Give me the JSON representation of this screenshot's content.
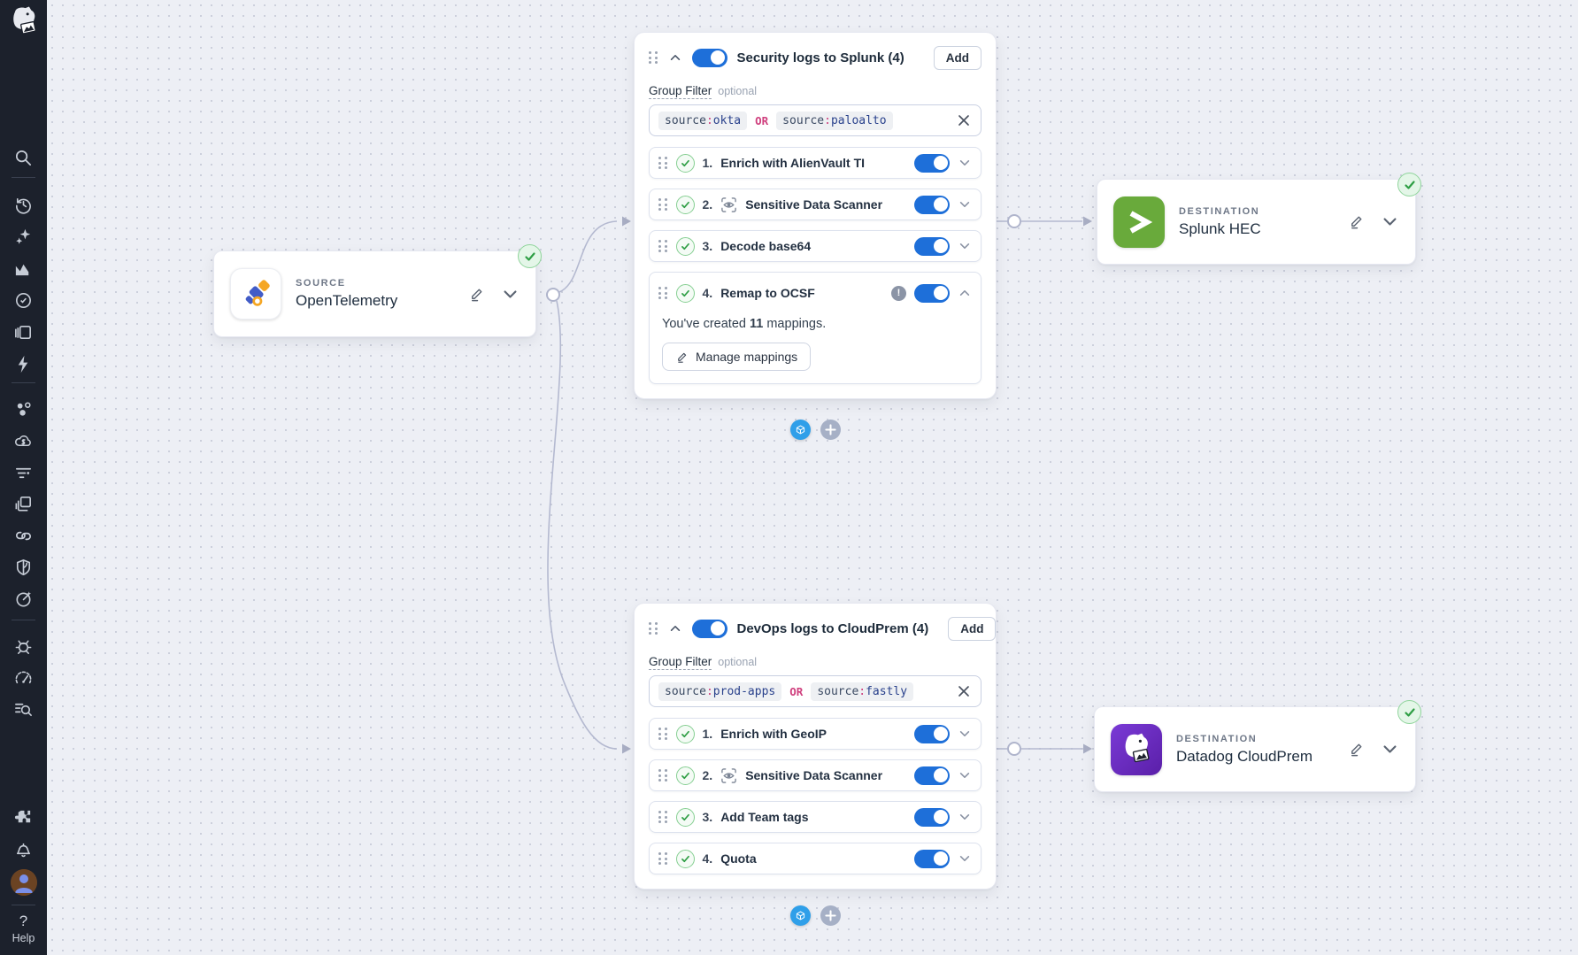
{
  "ui": {
    "colon": ":"
  },
  "sidebar": {
    "icons": [
      "datadog-logo",
      "search-icon",
      "history-icon",
      "sparkles-icon",
      "area-chart-icon",
      "target-check-icon",
      "layers-icon",
      "bolt-icon",
      "cluster-icon",
      "cloud-cost-icon",
      "filter-lines-icon",
      "windows-icon",
      "link-icon",
      "shield-icon",
      "gauge-star-icon",
      "bug-icon",
      "speedometer-icon",
      "log-search-icon",
      "puzzle-icon",
      "bell-icon",
      "avatar",
      "help-icon"
    ],
    "help_q": "?",
    "help_label": "Help"
  },
  "source": {
    "type_label": "SOURCE",
    "name": "OpenTelemetry"
  },
  "destinations": [
    {
      "type_label": "DESTINATION",
      "name": "Splunk HEC"
    },
    {
      "type_label": "DESTINATION",
      "name": "Datadog CloudPrem"
    }
  ],
  "groups": [
    {
      "title": "Security logs to Splunk (4)",
      "add_label": "Add",
      "filter_label": "Group Filter",
      "filter_optional": "optional",
      "chip1": {
        "field": "source",
        "value": "okta"
      },
      "or_label": "OR",
      "chip2": {
        "field": "source",
        "value": "paloalto"
      },
      "steps": [
        {
          "num": "1.",
          "label": "Enrich with AlienVault TI"
        },
        {
          "num": "2.",
          "label": "Sensitive Data Scanner"
        },
        {
          "num": "3.",
          "label": "Decode base64"
        },
        {
          "num": "4.",
          "label": "Remap to OCSF",
          "body_prefix": "You've created ",
          "body_count": "11",
          "body_suffix": " mappings.",
          "button_label": "Manage mappings"
        }
      ]
    },
    {
      "title": "DevOps logs to CloudPrem (4)",
      "add_label": "Add",
      "filter_label": "Group Filter",
      "filter_optional": "optional",
      "chip1": {
        "field": "source",
        "value": "prod-apps"
      },
      "or_label": "OR",
      "chip2": {
        "field": "source",
        "value": "fastly"
      },
      "steps": [
        {
          "num": "1.",
          "label": "Enrich with GeoIP"
        },
        {
          "num": "2.",
          "label": "Sensitive Data Scanner"
        },
        {
          "num": "3.",
          "label": "Add Team tags"
        },
        {
          "num": "4.",
          "label": "Quota"
        }
      ]
    }
  ],
  "colors": {
    "toggle_blue": "#1e6fd9",
    "splunk_green": "#69aa3b",
    "datadog_purple": "#6a2fc0",
    "success_green": "#2e9e44",
    "or_pink": "#cf3f7d",
    "wire_gray": "#b4b9d0",
    "sidebar_bg": "#1c212c",
    "canvas_bg": "#edeff5"
  }
}
